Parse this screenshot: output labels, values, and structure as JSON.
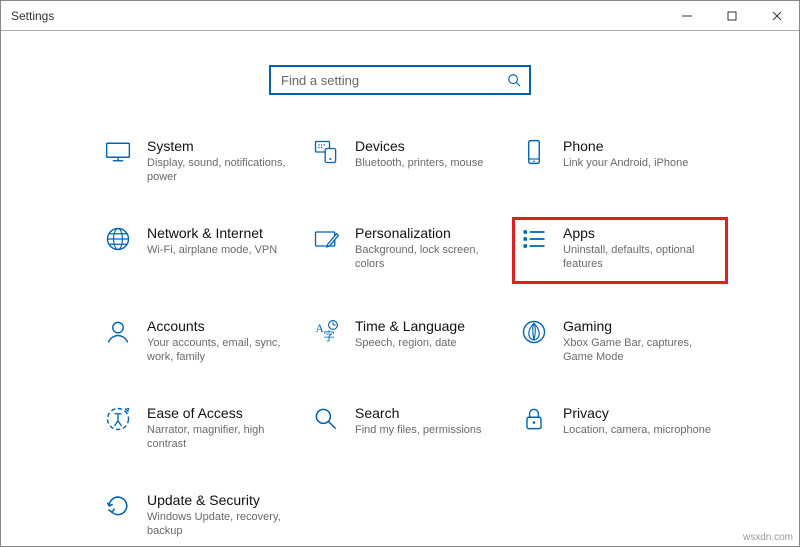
{
  "window": {
    "title": "Settings"
  },
  "search": {
    "placeholder": "Find a setting"
  },
  "tiles": {
    "system": {
      "title": "System",
      "sub": "Display, sound, notifications, power"
    },
    "devices": {
      "title": "Devices",
      "sub": "Bluetooth, printers, mouse"
    },
    "phone": {
      "title": "Phone",
      "sub": "Link your Android, iPhone"
    },
    "network": {
      "title": "Network & Internet",
      "sub": "Wi-Fi, airplane mode, VPN"
    },
    "personalize": {
      "title": "Personalization",
      "sub": "Background, lock screen, colors"
    },
    "apps": {
      "title": "Apps",
      "sub": "Uninstall, defaults, optional features"
    },
    "accounts": {
      "title": "Accounts",
      "sub": "Your accounts, email, sync, work, family"
    },
    "time": {
      "title": "Time & Language",
      "sub": "Speech, region, date"
    },
    "gaming": {
      "title": "Gaming",
      "sub": "Xbox Game Bar, captures, Game Mode"
    },
    "ease": {
      "title": "Ease of Access",
      "sub": "Narrator, magnifier, high contrast"
    },
    "search_cat": {
      "title": "Search",
      "sub": "Find my files, permissions"
    },
    "privacy": {
      "title": "Privacy",
      "sub": "Location, camera, microphone"
    },
    "update": {
      "title": "Update & Security",
      "sub": "Windows Update, recovery, backup"
    }
  },
  "attribution": "wsxdn.com"
}
